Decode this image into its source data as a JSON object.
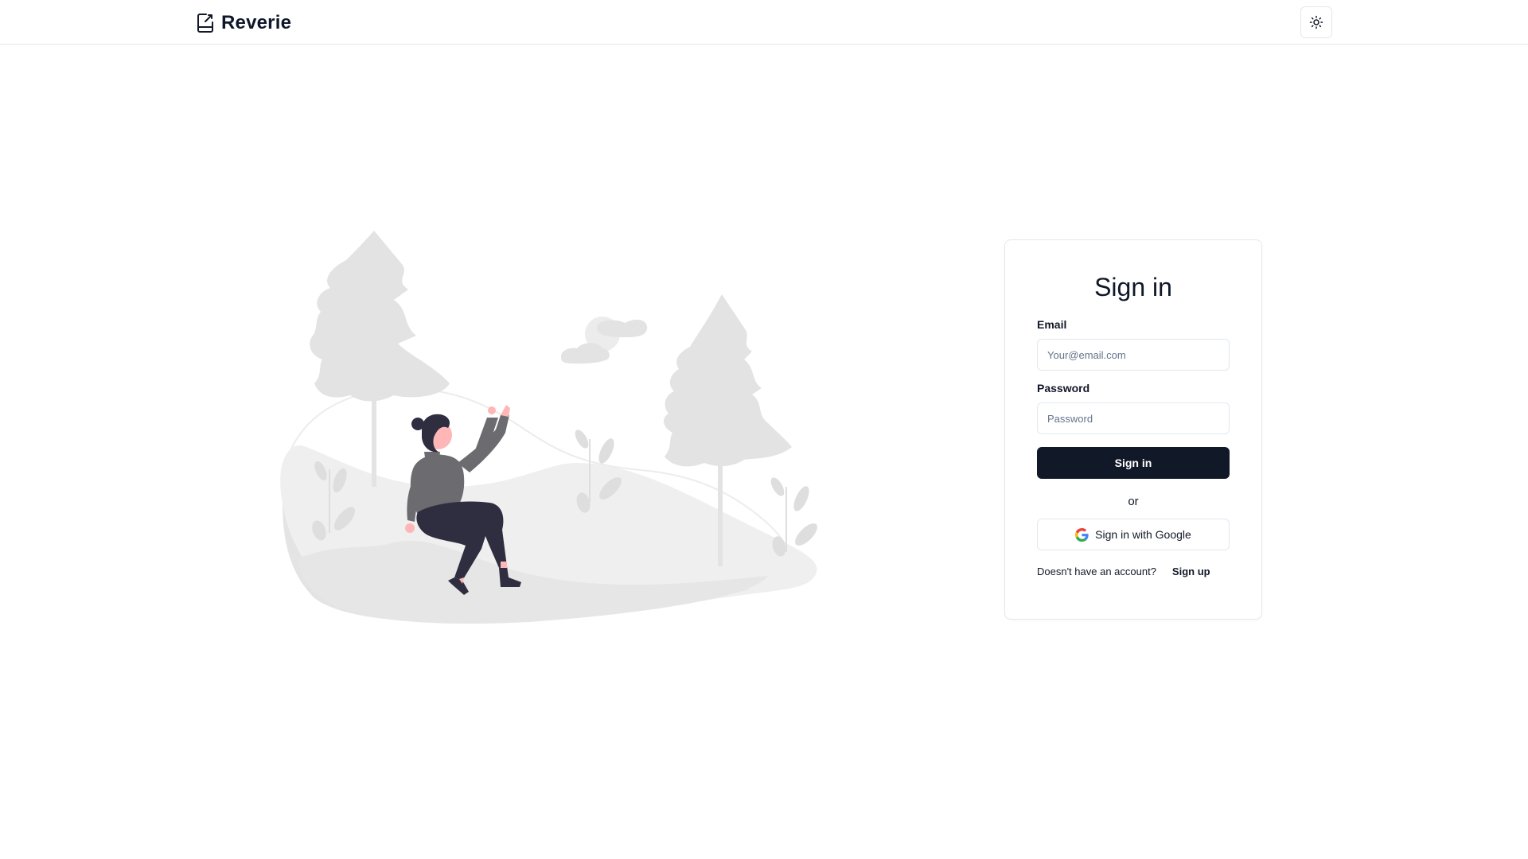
{
  "header": {
    "brand_name": "Reverie",
    "brand_icon": "notebook-icon",
    "theme_toggle_icon": "sun-icon"
  },
  "illustration": {
    "description_icon": "woman-in-forest-illustration",
    "colors": {
      "foliage": "#e5e5e5",
      "hill": "#f2f2f2",
      "sweater": "#6b6b70",
      "pants": "#2f2e41",
      "skin": "#ffb6b6"
    }
  },
  "signin": {
    "title": "Sign in",
    "email_label": "Email",
    "email_placeholder": "Your@email.com",
    "email_value": "",
    "password_label": "Password",
    "password_placeholder": "Password",
    "password_value": "",
    "submit_label": "Sign in",
    "or_text": "or",
    "google_label": "Sign in with Google",
    "google_icon": "google-icon",
    "signup_prompt": "Doesn't have an account?",
    "signup_link": "Sign up",
    "colors": {
      "primary_button": "#111827",
      "border": "#e2e8f0"
    }
  }
}
